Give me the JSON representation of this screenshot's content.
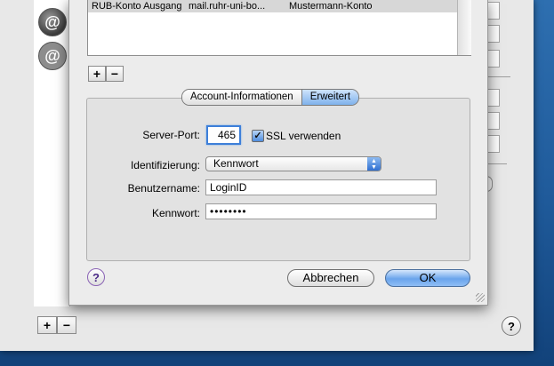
{
  "server_list": {
    "row": {
      "description": "RUB-Konto Ausgang",
      "server": "mail.ruhr-uni-bo...",
      "account": "Mustermann-Konto"
    },
    "add_label": "+",
    "remove_label": "−"
  },
  "tabs": [
    {
      "label": "Account-Informationen",
      "active": false
    },
    {
      "label": "Erweitert",
      "active": true
    }
  ],
  "form": {
    "port_label": "Server-Port:",
    "port_value": "465",
    "ssl_label": "SSL verwenden",
    "ssl_checked": true,
    "ssl_check_glyph": "✓",
    "auth_label": "Identifizierung:",
    "auth_value": "Kennwort",
    "auth_arrows": "▲▼",
    "user_label": "Benutzername:",
    "user_value": "LoginID",
    "password_label": "Kennwort:",
    "password_value": "••••••••"
  },
  "buttons": {
    "help": "?",
    "cancel": "Abbrechen",
    "ok": "OK"
  },
  "background_window": {
    "account_icon_glyph": "@",
    "add_label": "+",
    "remove_label": "−",
    "help": "?"
  },
  "colors": {
    "focus_ring": "#3d7fd9",
    "default_button": "#6aa4ec",
    "desktop": "#1f5a9a"
  }
}
